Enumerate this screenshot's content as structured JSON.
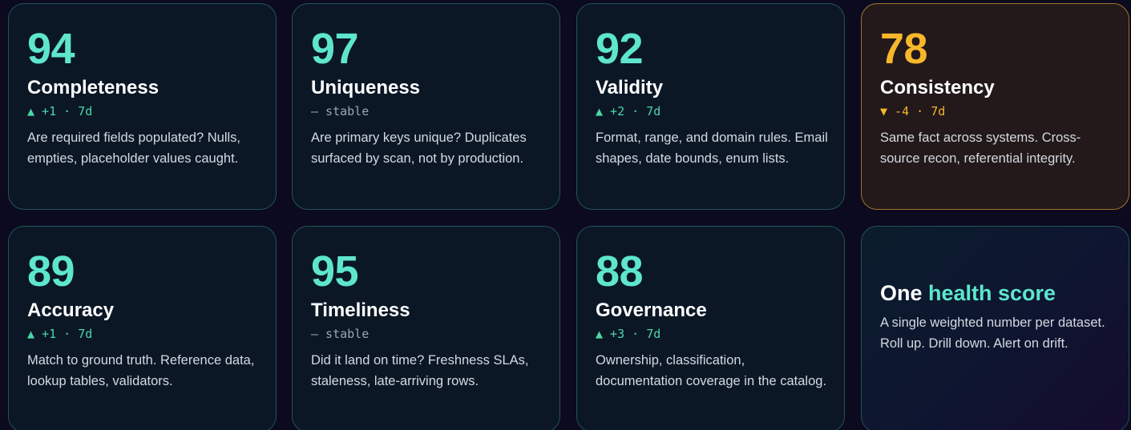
{
  "cards": [
    {
      "score": "94",
      "title": "Completeness",
      "trend": "▲ +1 · 7d",
      "desc": "Are required fields populated? Nulls, empties, placeholder values caught."
    },
    {
      "score": "97",
      "title": "Uniqueness",
      "trend": "— stable",
      "desc": "Are primary keys unique? Duplicates surfaced by scan, not by production."
    },
    {
      "score": "92",
      "title": "Validity",
      "trend": "▲ +2 · 7d",
      "desc": "Format, range, and domain rules. Email shapes, date bounds, enum lists."
    },
    {
      "score": "78",
      "title": "Consistency",
      "trend": "▼ -4 · 7d",
      "desc": "Same fact across systems. Cross-source recon, referential integrity."
    },
    {
      "score": "89",
      "title": "Accuracy",
      "trend": "▲ +1 · 7d",
      "desc": "Match to ground truth. Reference data, lookup tables, validators."
    },
    {
      "score": "95",
      "title": "Timeliness",
      "trend": "— stable",
      "desc": "Did it land on time? Freshness SLAs, staleness, late-arriving rows."
    },
    {
      "score": "88",
      "title": "Governance",
      "trend": "▲ +3 · 7d",
      "desc": "Ownership, classification, documentation coverage in the catalog."
    }
  ],
  "summary": {
    "title_lead": "One ",
    "title_accent": "health score",
    "desc": "A single weighted number per dataset. Roll up. Drill down. Alert on drift."
  },
  "colors": {
    "accent": "#5ee6cd",
    "warning": "#f6b72b",
    "trend_up": "#4cd6a8",
    "stable": "#9aa6b2"
  }
}
